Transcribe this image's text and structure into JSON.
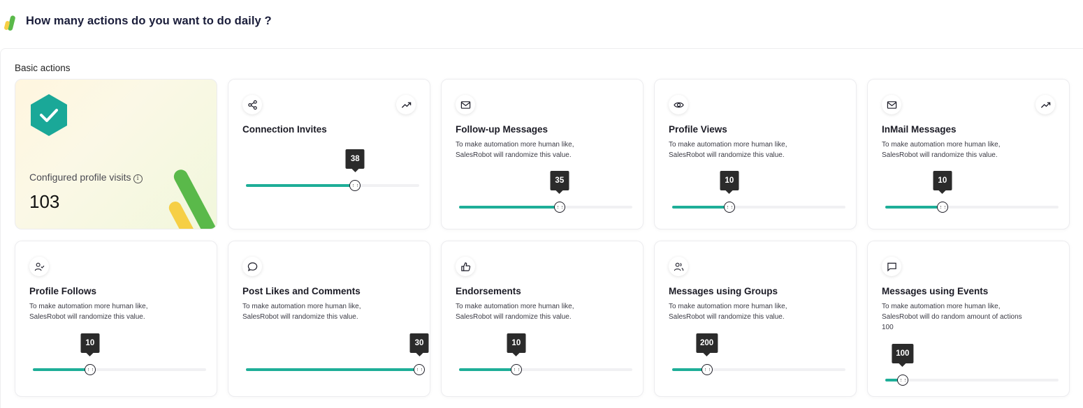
{
  "header": {
    "title": "How many actions do you want to do daily ?"
  },
  "section": {
    "title": "Basic actions"
  },
  "profile": {
    "label": "Configured profile visits",
    "info_icon": "info-icon",
    "value": "103"
  },
  "colors": {
    "accent": "#1eae98",
    "hex_badge": "#1aa898",
    "logo_green": "#5ab94a",
    "logo_yellow": "#f6cf45"
  },
  "cards": [
    {
      "title": "Connection Invites",
      "icon": "share-icon",
      "trend": true,
      "desc1": "",
      "desc2": "",
      "desc3": "",
      "value": "38",
      "fraction": 0.63
    },
    {
      "title": "Follow-up Messages",
      "icon": "mail-icon",
      "trend": false,
      "desc1": "To make automation more human like,",
      "desc2": "SalesRobot will randomize this value.",
      "desc3": "",
      "value": "35",
      "fraction": 0.58
    },
    {
      "title": "Profile Views",
      "icon": "eye-icon",
      "trend": false,
      "desc1": "To make automation more human like,",
      "desc2": "SalesRobot will randomize this value.",
      "desc3": "",
      "value": "10",
      "fraction": 0.33
    },
    {
      "title": "InMail Messages",
      "icon": "mail-icon",
      "trend": true,
      "desc1": "To make automation more human like,",
      "desc2": "SalesRobot will randomize this value.",
      "desc3": "",
      "value": "10",
      "fraction": 0.33
    },
    {
      "title": "Profile Follows",
      "icon": "user-check-icon",
      "trend": false,
      "desc1": "To make automation more human like,",
      "desc2": "SalesRobot will randomize this value.",
      "desc3": "",
      "value": "10",
      "fraction": 0.33
    },
    {
      "title": "Post Likes and Comments",
      "icon": "comment-icon",
      "trend": false,
      "desc1": "To make automation more human like,",
      "desc2": "SalesRobot will randomize this value.",
      "desc3": "",
      "value": "30",
      "fraction": 1.0
    },
    {
      "title": "Endorsements",
      "icon": "thumbs-up-icon",
      "trend": false,
      "desc1": "To make automation more human like,",
      "desc2": "SalesRobot will randomize this value.",
      "desc3": "",
      "value": "10",
      "fraction": 0.33
    },
    {
      "title": "Messages using Groups",
      "icon": "users-icon",
      "trend": false,
      "desc1": "To make automation more human like,",
      "desc2": "SalesRobot will randomize this value.",
      "desc3": "",
      "value": "200",
      "fraction": 0.2
    },
    {
      "title": "Messages using Events",
      "icon": "message-square-icon",
      "trend": false,
      "desc1": "To make automation more human like,",
      "desc2": "SalesRobot will do random amount of actions",
      "desc3": "100",
      "value": "100",
      "fraction": 0.1
    }
  ]
}
